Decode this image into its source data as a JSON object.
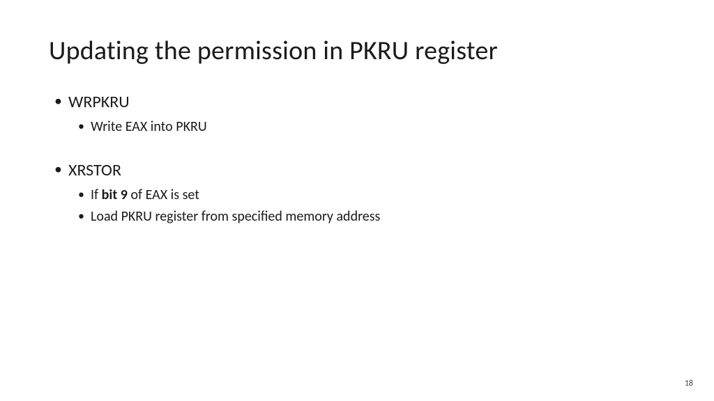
{
  "title": "Updating the permission in PKRU register",
  "bullets": {
    "g1": {
      "header": "WRPKRU",
      "items": {
        "a": "Write EAX into PKRU"
      }
    },
    "g2": {
      "header": "XRSTOR",
      "items": {
        "a_pre": "If ",
        "a_bold": "bit 9",
        "a_post": " of EAX is set",
        "b": "Load PKRU register from specified memory address"
      }
    }
  },
  "page_number": "18"
}
